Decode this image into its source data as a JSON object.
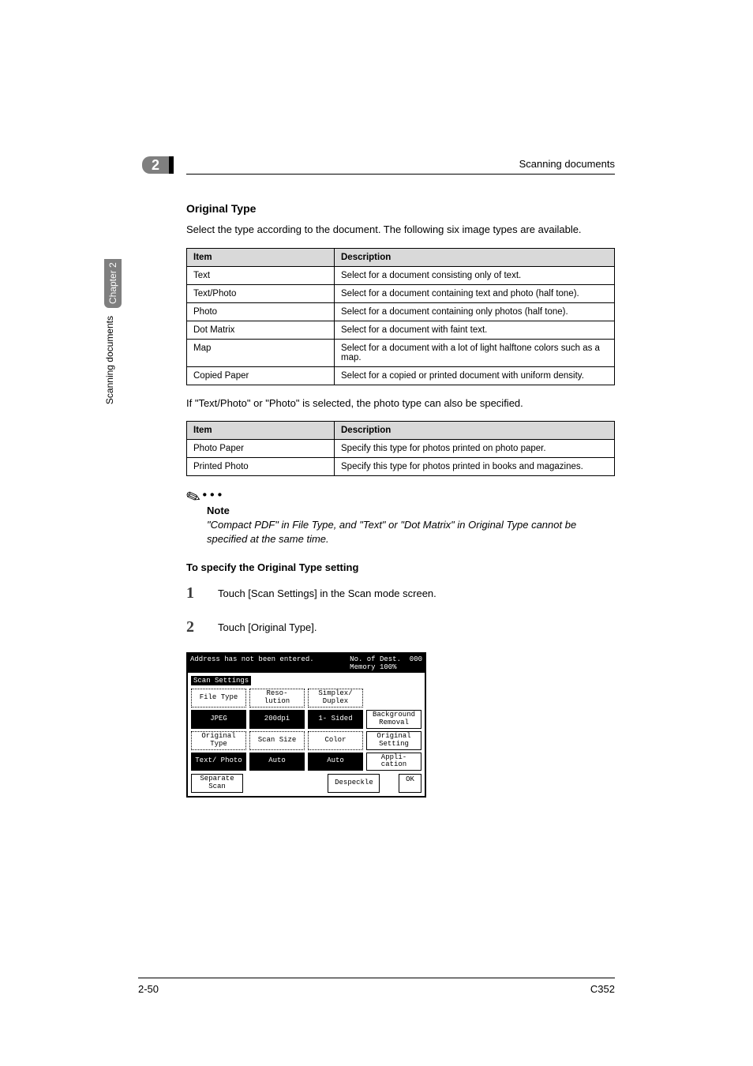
{
  "running_head": "Scanning documents",
  "chapter_marker": "2",
  "side_tab": "Chapter 2",
  "side_text": "Scanning documents",
  "section_title": "Original Type",
  "intro": "Select the type according to the document. The following six image types are available.",
  "table1": {
    "headers": [
      "Item",
      "Description"
    ],
    "rows": [
      [
        "Text",
        "Select for a document consisting only of text."
      ],
      [
        "Text/Photo",
        "Select for a document containing text and photo (half tone)."
      ],
      [
        "Photo",
        "Select for a document containing only photos (half tone)."
      ],
      [
        "Dot Matrix",
        "Select for a document with faint text."
      ],
      [
        "Map",
        "Select for a document with a lot of light halftone colors such as a map."
      ],
      [
        "Copied Paper",
        "Select for a copied or printed document with uniform density."
      ]
    ]
  },
  "mid_sentence": "If \"Text/Photo\" or \"Photo\" is selected, the photo type can also be specified.",
  "table2": {
    "headers": [
      "Item",
      "Description"
    ],
    "rows": [
      [
        "Photo Paper",
        "Specify this type for photos printed on photo paper."
      ],
      [
        "Printed Photo",
        "Specify this type for photos printed in books and magazines."
      ]
    ]
  },
  "note_label": "Note",
  "note_body": "\"Compact PDF\" in File Type, and \"Text\" or \"Dot Matrix\" in Original Type cannot be specified at the same time.",
  "procedure_title": "To specify the Original Type setting",
  "steps": [
    "Touch [Scan Settings] in the Scan mode screen.",
    "Touch [Original Type]."
  ],
  "lcd": {
    "status": "Address has not been entered.",
    "dest_label": "No. of Dest.",
    "dest_value": "000",
    "memory": "Memory 100%",
    "panel_title": "Scan Settings",
    "r1": [
      "File Type",
      "Reso- lution",
      "Simplex/ Duplex",
      ""
    ],
    "r1v": [
      "JPEG",
      "200dpi",
      "1- Sided",
      "Background Removal"
    ],
    "r2": [
      "Original Type",
      "Scan Size",
      "Color",
      "Original Setting"
    ],
    "r2v": [
      "Text/ Photo",
      "Auto",
      "Auto",
      "Appli- cation"
    ],
    "r3": [
      "Separate Scan",
      "",
      "Despeckle",
      "OK"
    ]
  },
  "footer_left": "2-50",
  "footer_right": "C352"
}
